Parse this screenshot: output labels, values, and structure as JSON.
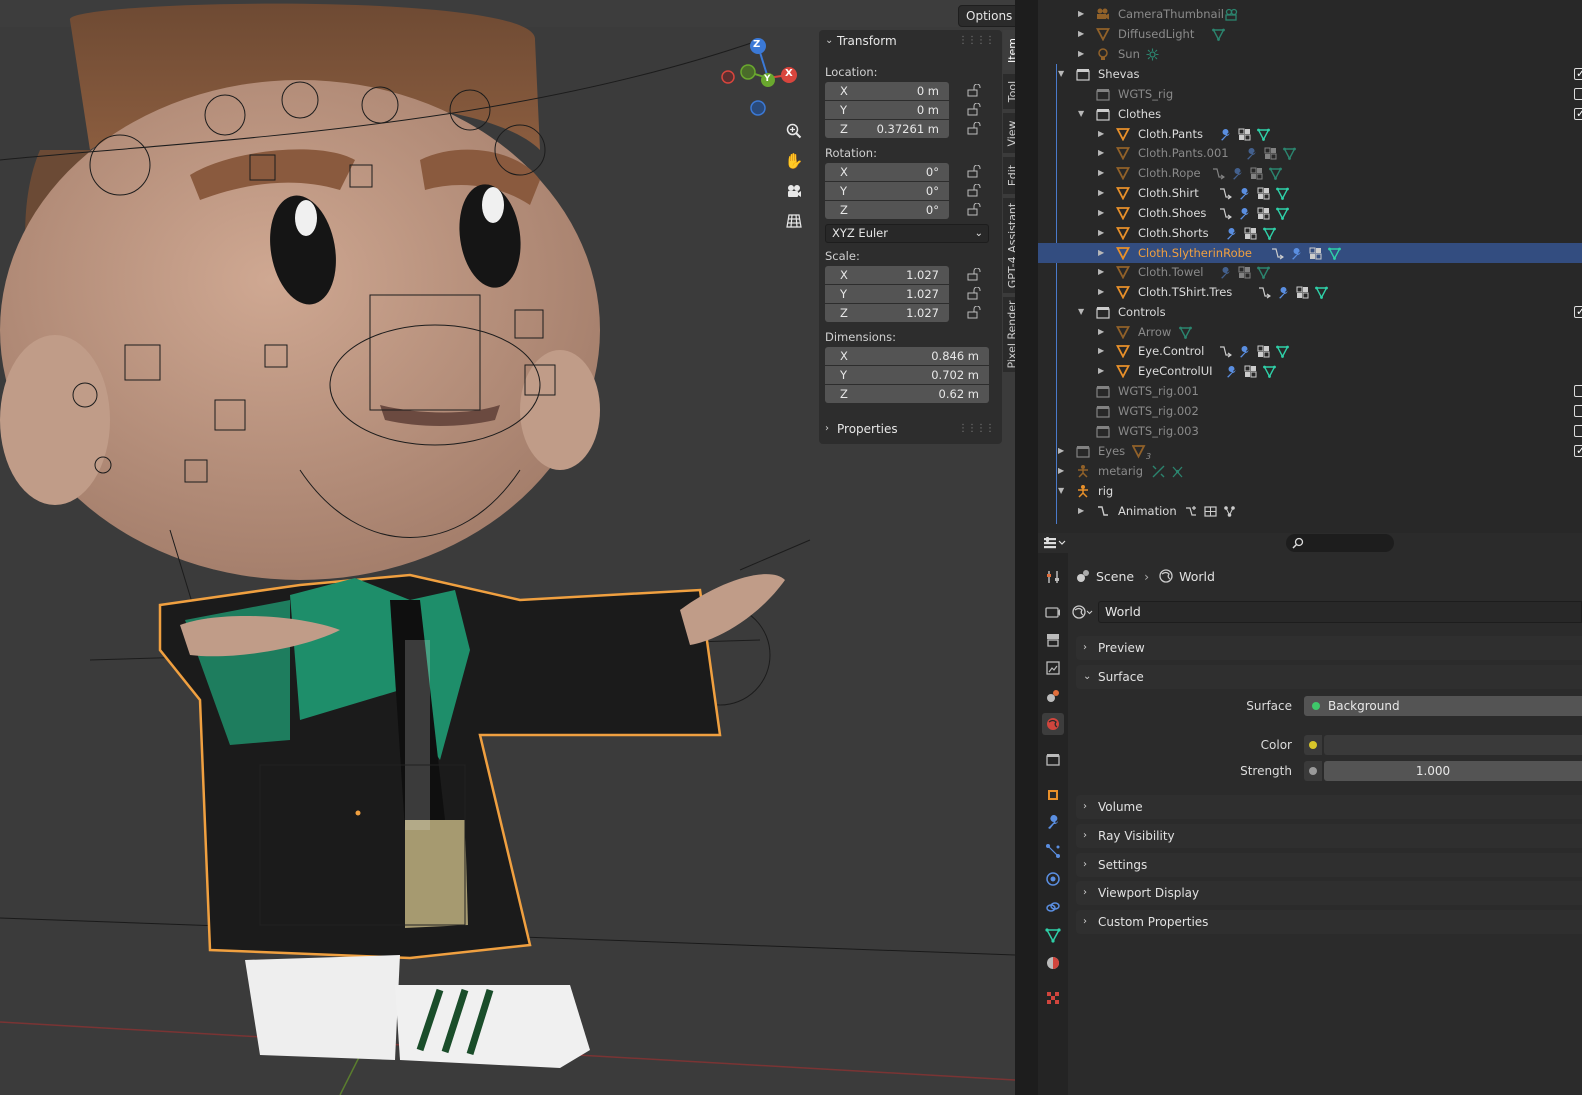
{
  "viewport": {
    "options_label": "Options",
    "gizmo_axes": {
      "z": "Z",
      "y": "Y",
      "x": "X"
    },
    "nav_icons": [
      "zoom-icon",
      "pan-hand-icon",
      "camera-view-icon",
      "grid-ortho-icon"
    ]
  },
  "transform": {
    "title": "Transform",
    "location_label": "Location:",
    "location": [
      {
        "axis": "X",
        "value": "0 m"
      },
      {
        "axis": "Y",
        "value": "0 m"
      },
      {
        "axis": "Z",
        "value": "0.37261 m"
      }
    ],
    "rotation_label": "Rotation:",
    "rotation": [
      {
        "axis": "X",
        "value": "0°"
      },
      {
        "axis": "Y",
        "value": "0°"
      },
      {
        "axis": "Z",
        "value": "0°"
      }
    ],
    "rotation_mode": "XYZ Euler",
    "scale_label": "Scale:",
    "scale": [
      {
        "axis": "X",
        "value": "1.027"
      },
      {
        "axis": "Y",
        "value": "1.027"
      },
      {
        "axis": "Z",
        "value": "1.027"
      }
    ],
    "dimensions_label": "Dimensions:",
    "dimensions": [
      {
        "axis": "X",
        "value": "0.846 m"
      },
      {
        "axis": "Y",
        "value": "0.702 m"
      },
      {
        "axis": "Z",
        "value": "0.62 m"
      }
    ],
    "properties_label": "Properties"
  },
  "sidebar_tabs": [
    "Item",
    "Tool",
    "View",
    "Edit",
    "GPT-4 Assistant",
    "Pixel Render"
  ],
  "outliner": {
    "rows": [
      {
        "label": "CameraThumbnail",
        "type": "camera",
        "dim": true
      },
      {
        "label": "DiffusedLight",
        "type": "mesh",
        "dim": true
      },
      {
        "label": "Sun",
        "type": "light",
        "dim": true
      },
      {
        "label": "Shevas",
        "type": "collection"
      },
      {
        "label": "WGTS_rig",
        "type": "collection",
        "dim": true
      },
      {
        "label": "Clothes",
        "type": "collection"
      },
      {
        "label": "Cloth.Pants",
        "type": "mesh"
      },
      {
        "label": "Cloth.Pants.001",
        "type": "mesh",
        "dim": true
      },
      {
        "label": "Cloth.Rope",
        "type": "mesh",
        "dim": true
      },
      {
        "label": "Cloth.Shirt",
        "type": "mesh"
      },
      {
        "label": "Cloth.Shoes",
        "type": "mesh"
      },
      {
        "label": "Cloth.Shorts",
        "type": "mesh"
      },
      {
        "label": "Cloth.SlytherinRobe",
        "type": "mesh",
        "selected": true
      },
      {
        "label": "Cloth.Towel",
        "type": "mesh",
        "dim": true
      },
      {
        "label": "Cloth.TShirt.Tres",
        "type": "mesh"
      },
      {
        "label": "Controls",
        "type": "collection"
      },
      {
        "label": "Arrow",
        "type": "mesh",
        "dim": true
      },
      {
        "label": "Eye.Control",
        "type": "mesh"
      },
      {
        "label": "EyeControlUI",
        "type": "mesh"
      },
      {
        "label": "WGTS_rig.001",
        "type": "collection",
        "dim": true
      },
      {
        "label": "WGTS_rig.002",
        "type": "collection",
        "dim": true
      },
      {
        "label": "WGTS_rig.003",
        "type": "collection",
        "dim": true
      },
      {
        "label": "Eyes",
        "type": "collection",
        "dim": true,
        "badge": "3"
      },
      {
        "label": "metarig",
        "type": "armature",
        "dim": true
      },
      {
        "label": "rig",
        "type": "armature"
      },
      {
        "label": "Animation",
        "type": "action"
      }
    ]
  },
  "properties": {
    "breadcrumb": [
      "Scene",
      "World"
    ],
    "datablock": "World",
    "panels": {
      "preview": "Preview",
      "surface": "Surface",
      "volume": "Volume",
      "ray_visibility": "Ray Visibility",
      "settings": "Settings",
      "viewport_display": "Viewport Display",
      "custom_properties": "Custom Properties"
    },
    "surface_label": "Surface",
    "surface_value": "Background",
    "color_label": "Color",
    "strength_label": "Strength",
    "strength_value": "1.000"
  },
  "colors": {
    "selection": "#334d80",
    "selected_text": "#f0a040",
    "object_orange": "#e8902a",
    "modifier_blue": "#5a8ee0",
    "mesh_green": "#2fd0a8",
    "robe_green": "#1e8e6a"
  }
}
